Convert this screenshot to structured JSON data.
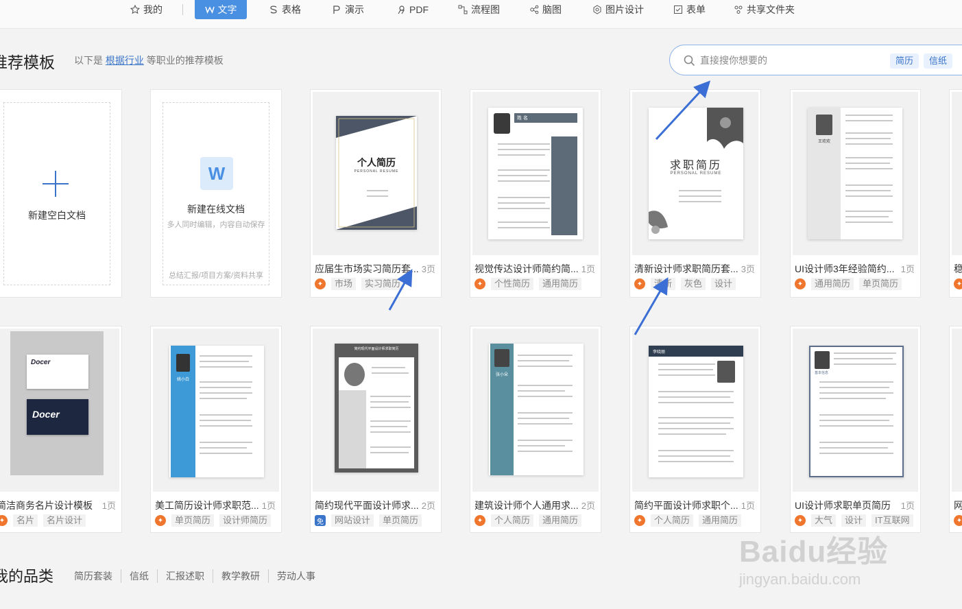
{
  "nav": {
    "items": [
      {
        "label": "我的",
        "icon": "star-icon"
      },
      {
        "label": "文字",
        "icon": "writer-icon",
        "active": true
      },
      {
        "label": "表格",
        "icon": "sheet-icon"
      },
      {
        "label": "演示",
        "icon": "presentation-icon"
      },
      {
        "label": "PDF",
        "icon": "pdf-icon"
      },
      {
        "label": "流程图",
        "icon": "flowchart-icon"
      },
      {
        "label": "脑图",
        "icon": "mindmap-icon"
      },
      {
        "label": "图片设计",
        "icon": "image-design-icon"
      },
      {
        "label": "表单",
        "icon": "form-icon"
      },
      {
        "label": "共享文件夹",
        "icon": "shared-folder-icon"
      }
    ]
  },
  "section": {
    "title": "推荐模板",
    "sub_prefix": "以下是",
    "sub_link": "根据行业",
    "sub_suffix": "等职业的推荐模板"
  },
  "search": {
    "placeholder": "直接搜你想要的",
    "tags": [
      "简历",
      "信纸"
    ]
  },
  "create": {
    "blank_label": "新建空白文档",
    "online_label": "新建在线文档",
    "online_desc": "多人同时编辑，内容自动保存",
    "online_footer": "总结汇报/项目方案/资料共享",
    "online_icon_letter": "W"
  },
  "row1": [
    {
      "title": "应届生市场实习简历套...",
      "pages": "3页",
      "tags": [
        "市场",
        "实习简历"
      ],
      "cover_title": "个人简历",
      "cover_sub": "PERSONAL RESUME"
    },
    {
      "title": "视觉传达设计师简约简...",
      "pages": "1页",
      "tags": [
        "个性简历",
        "通用简历"
      ],
      "cover_title": "姓 名"
    },
    {
      "title": "清新设计师求职简历套...",
      "pages": "3页",
      "tags": [
        "清新",
        "灰色",
        "设计"
      ],
      "cover_title": "求职简历",
      "cover_sub": "PERSONAL RESUME"
    },
    {
      "title": "UI设计师3年经验简约...",
      "pages": "1页",
      "tags": [
        "通用简历",
        "单页简历"
      ],
      "cover_title": "王欢欢"
    },
    {
      "title": "稳",
      "pages": "",
      "tags": []
    }
  ],
  "row2": [
    {
      "title": "简洁商务名片设计模板",
      "pages": "1页",
      "tags": [
        "名片",
        "名片设计"
      ],
      "cover_title": "Docer"
    },
    {
      "title": "美工简历设计师求职范...",
      "pages": "1页",
      "tags": [
        "单页简历",
        "设计师简历"
      ],
      "cover_title": "姚小白"
    },
    {
      "title": "简约现代平面设计师求...",
      "pages": "2页",
      "tags": [
        "网站设计",
        "单页简历"
      ],
      "cover_title": "简约现代平面设计师求职简历",
      "badge": "免"
    },
    {
      "title": "建筑设计师个人通用求...",
      "pages": "2页",
      "tags": [
        "个人简历",
        "通用简历"
      ],
      "cover_title": "张小朵"
    },
    {
      "title": "简约平面设计师求职个...",
      "pages": "1页",
      "tags": [
        "个人简历",
        "通用简历"
      ],
      "cover_title": "李晓丽"
    },
    {
      "title": "UI设计师求职单页简历",
      "pages": "1页",
      "tags": [
        "大气",
        "设计",
        "IT互联网"
      ],
      "cover_title": "基本信息"
    },
    {
      "title": "网",
      "pages": "",
      "tags": []
    }
  ],
  "bottom": {
    "title": "我的品类",
    "categories": [
      "简历套装",
      "信纸",
      "汇报述职",
      "教学教研",
      "劳动人事"
    ]
  },
  "watermark": {
    "brand": "Baidu经验",
    "url": "jingyan.baidu.com"
  },
  "colors": {
    "accent": "#4a90e2",
    "link": "#3a74c9",
    "badge": "#f0762e",
    "arrow": "#3b6fd6"
  }
}
